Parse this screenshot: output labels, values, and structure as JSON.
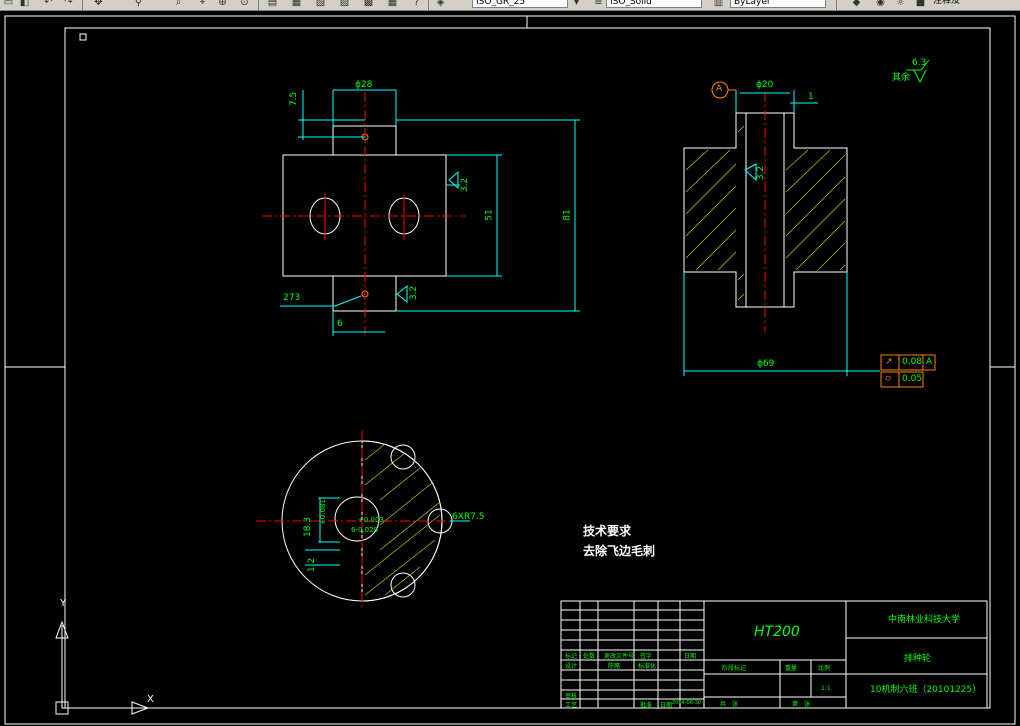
{
  "toolbar": {
    "layer_combo": "ISO_GR_25",
    "linetype_combo": "ISO_Solid",
    "lineweight_combo": "ByLayer",
    "right_text": "注释及"
  },
  "dims": {
    "d28": "ϕ28",
    "d7_5": "7.5",
    "r3_2a": "3.2",
    "d51": "51",
    "d81": "81",
    "d273": "273",
    "r3_2b": "3.2",
    "d6": "6",
    "datumA": "A",
    "d20": "ϕ20",
    "d1": "1",
    "r3_2c": "3.2",
    "d69": "ϕ69",
    "rough_label": "其余",
    "rough_val": "6.3",
    "gtol_val1": "0.08",
    "gtol_ref": "A",
    "gtol_val2": "0.05",
    "d18": "18.3",
    "tol_up": "+0.003",
    "tol_dn": "6-0.029",
    "d18b": "+0.081",
    "d6xr": "6XR7.5",
    "d1_2": "1.2"
  },
  "notes": {
    "title": "技术要求",
    "line1": "去除飞边毛刺"
  },
  "title_block": {
    "material": "HT200",
    "school": "中南林业科技大学",
    "part_name": "排种轮",
    "drawing_no": "10机制六班（20101225）",
    "scale_label": "比例",
    "weight_label": "重量",
    "mark_label": "阶段标记",
    "scale_val": "1:1",
    "sheet_label": "共　张",
    "page_label": "第　张",
    "design_label": "设计",
    "review_label": "审核",
    "process_label": "工艺",
    "date_label": "日期",
    "date_val": "2014-06-30",
    "std_label": "标准化",
    "approve_label": "批准",
    "mark_h": "标记",
    "count_h": "处数",
    "file_h": "更改文件号",
    "sign_h": "签字",
    "date_h": "日期",
    "designer": "陈略"
  },
  "ucs": {
    "y_label": "Y",
    "x_label": "X"
  }
}
